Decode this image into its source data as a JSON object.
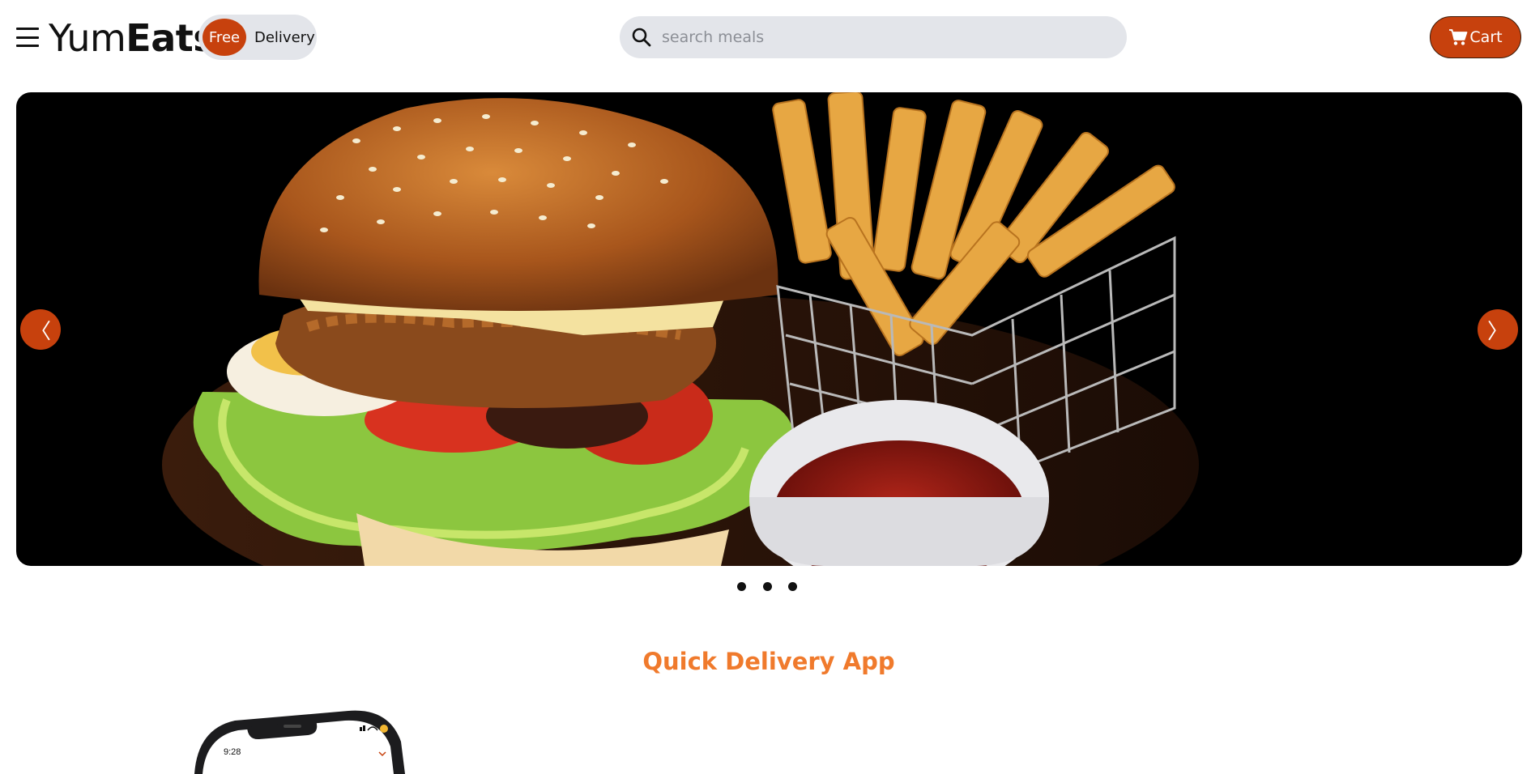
{
  "header": {
    "logo_regular": "Yum",
    "logo_bold": "Eats",
    "delivery_badge": {
      "free": "Free",
      "label": "Delivery"
    },
    "search": {
      "placeholder": "search meals",
      "value": ""
    },
    "cart_label": "Cart"
  },
  "hero": {
    "prev_symbol": "〈",
    "next_symbol": "〉",
    "slides_count": 3,
    "active_slide": 1
  },
  "sections": {
    "quick_delivery_title": "Quick Delivery App",
    "phone_status_time": "9:28"
  },
  "colors": {
    "accent": "#c7410d",
    "title": "#f07a2c",
    "pill_bg": "#e3e5ea"
  },
  "icons": {
    "menu": "hamburger-icon",
    "search": "search-icon",
    "cart": "cart-icon"
  }
}
